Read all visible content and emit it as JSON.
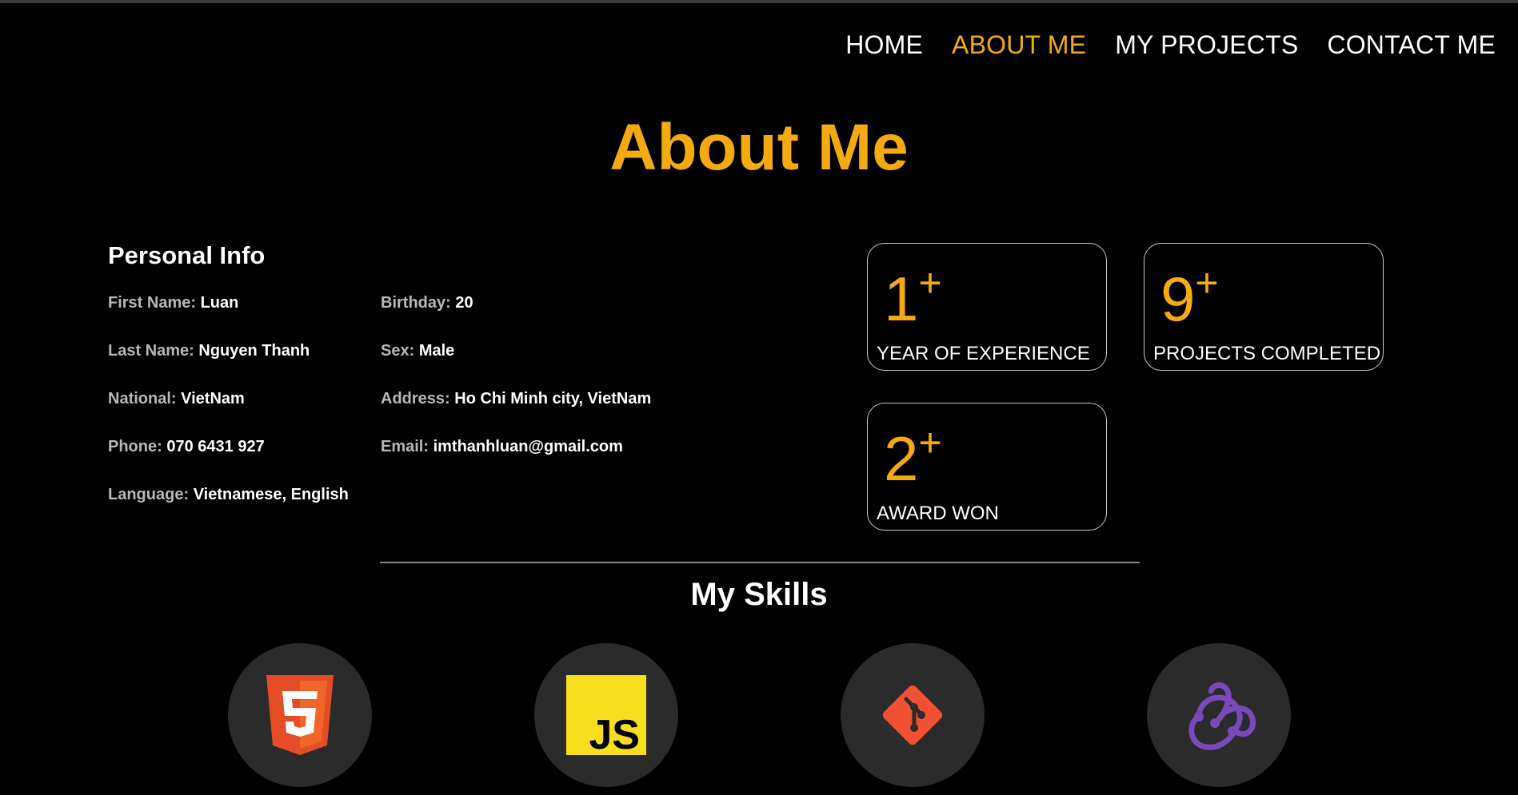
{
  "nav": {
    "items": [
      {
        "label": "HOME",
        "active": false
      },
      {
        "label": "ABOUT ME",
        "active": true
      },
      {
        "label": "MY PROJECTS",
        "active": false
      },
      {
        "label": "CONTACT ME",
        "active": false
      }
    ]
  },
  "page_title": "About Me",
  "personal_info": {
    "heading": "Personal Info",
    "left": [
      {
        "label": "First Name:",
        "value": "Luan"
      },
      {
        "label": "Last Name:",
        "value": "Nguyen Thanh"
      },
      {
        "label": "National:",
        "value": "VietNam"
      },
      {
        "label": "Phone:",
        "value": "070 6431 927"
      },
      {
        "label": "Language:",
        "value": "Vietnamese, English"
      }
    ],
    "right": [
      {
        "label": "Birthday:",
        "value": "20"
      },
      {
        "label": "Sex:",
        "value": "Male"
      },
      {
        "label": "Address:",
        "value": "Ho Chi Minh city, VietNam"
      },
      {
        "label": "Email:",
        "value": "imthanhluan@gmail.com"
      }
    ]
  },
  "stats": [
    {
      "number": "1",
      "suffix": "+",
      "caption": "YEAR OF EXPERIENCE"
    },
    {
      "number": "9",
      "suffix": "+",
      "caption": "PROJECTS COMPLETED"
    },
    {
      "number": "2",
      "suffix": "+",
      "caption": "AWARD WON"
    }
  ],
  "skills": {
    "title": "My Skills",
    "icons": [
      "html5-icon",
      "javascript-icon",
      "git-icon",
      "redux-icon"
    ],
    "js_text": "JS",
    "html_text": "5"
  },
  "colors": {
    "accent": "#f5ab0f",
    "background": "#000000",
    "skill_circle": "#2b2b2b"
  }
}
